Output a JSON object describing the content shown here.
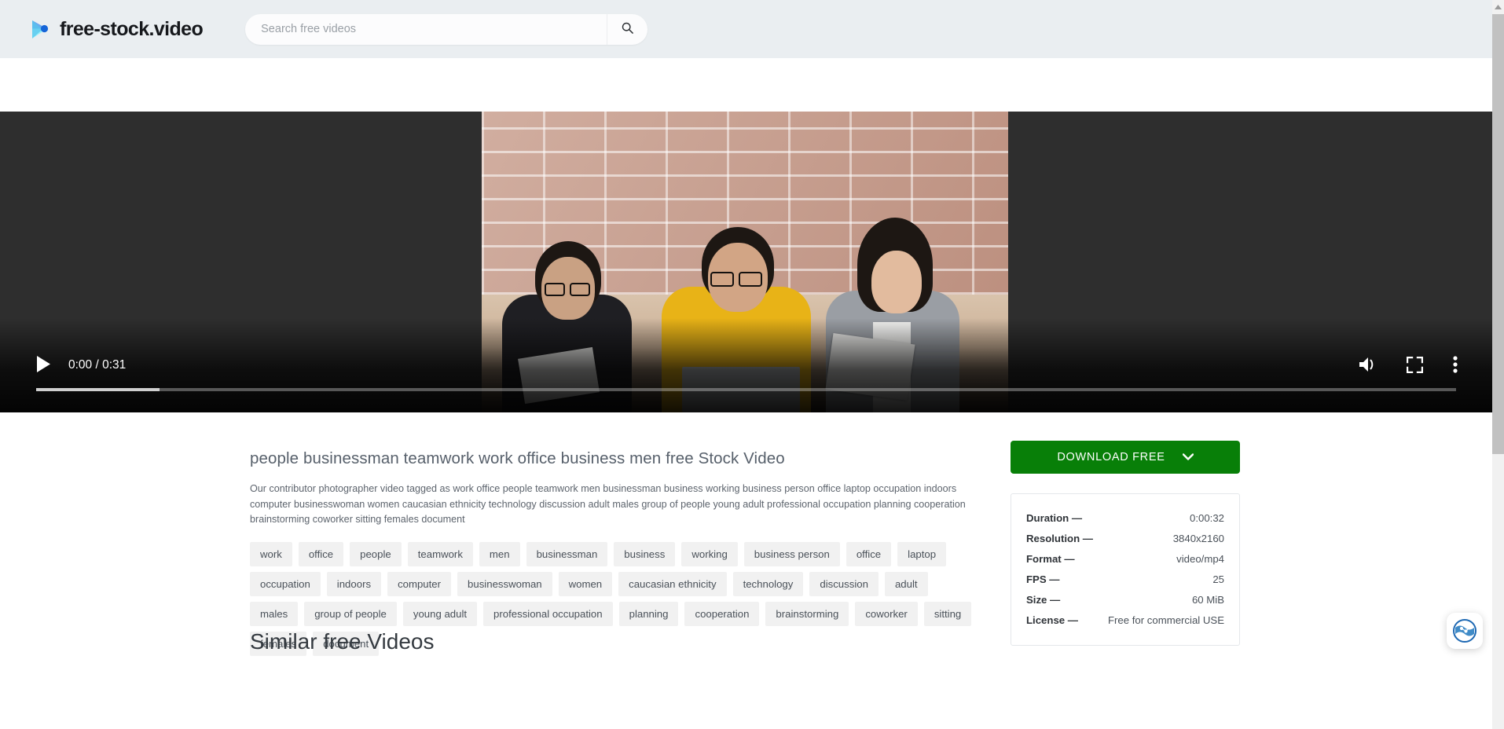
{
  "header": {
    "logo_text": "free-stock.video",
    "logo_icon": "play-triangle-logo-icon",
    "search": {
      "placeholder": "Search free videos",
      "value": "",
      "icon": "search-icon"
    }
  },
  "player": {
    "current_time": "0:00",
    "duration": "0:31",
    "time_display": "0:00 / 0:31",
    "progress_percent": 8.7,
    "play_icon": "play-icon",
    "volume_icon": "volume-on-icon",
    "fullscreen_icon": "fullscreen-icon",
    "more_icon": "more-vertical-icon"
  },
  "video": {
    "title": "people businessman teamwork work office business men free Stock Video",
    "description": "Our contributor photographer video tagged as work office people teamwork men businessman business working business person office laptop occupation indoors computer businesswoman women caucasian ethnicity technology discussion adult males group of people young adult professional occupation planning cooperation brainstorming coworker sitting females document",
    "tags": [
      "work",
      "office",
      "people",
      "teamwork",
      "men",
      "businessman",
      "business",
      "working",
      "business person",
      "office",
      "laptop",
      "occupation",
      "indoors",
      "computer",
      "businesswoman",
      "women",
      "caucasian ethnicity",
      "technology",
      "discussion",
      "adult",
      "males",
      "group of people",
      "young adult",
      "professional occupation",
      "planning",
      "cooperation",
      "brainstorming",
      "coworker",
      "sitting",
      "females",
      "document"
    ]
  },
  "download": {
    "label": "DOWNLOAD FREE",
    "chevron_icon": "chevron-down-icon",
    "color": "#087f08"
  },
  "info": {
    "rows": [
      {
        "key": "Duration —",
        "value": "0:00:32"
      },
      {
        "key": "Resolution —",
        "value": "3840x2160"
      },
      {
        "key": "Format —",
        "value": "video/mp4"
      },
      {
        "key": "FPS —",
        "value": "25"
      },
      {
        "key": "Size —",
        "value": "60 MiB"
      },
      {
        "key": "License —",
        "value": "Free for commercial USE"
      }
    ]
  },
  "similar": {
    "heading": "Similar free Videos"
  },
  "widget": {
    "icon": "accessibility-widget-icon"
  },
  "colors": {
    "header_bg": "#eaeef1",
    "player_bg": "#2e2e2e",
    "accent_green": "#087f08",
    "logo_blue": "#2f7fe8",
    "logo_cyan": "#8fe8f5",
    "tag_bg": "#f1f1f1"
  }
}
